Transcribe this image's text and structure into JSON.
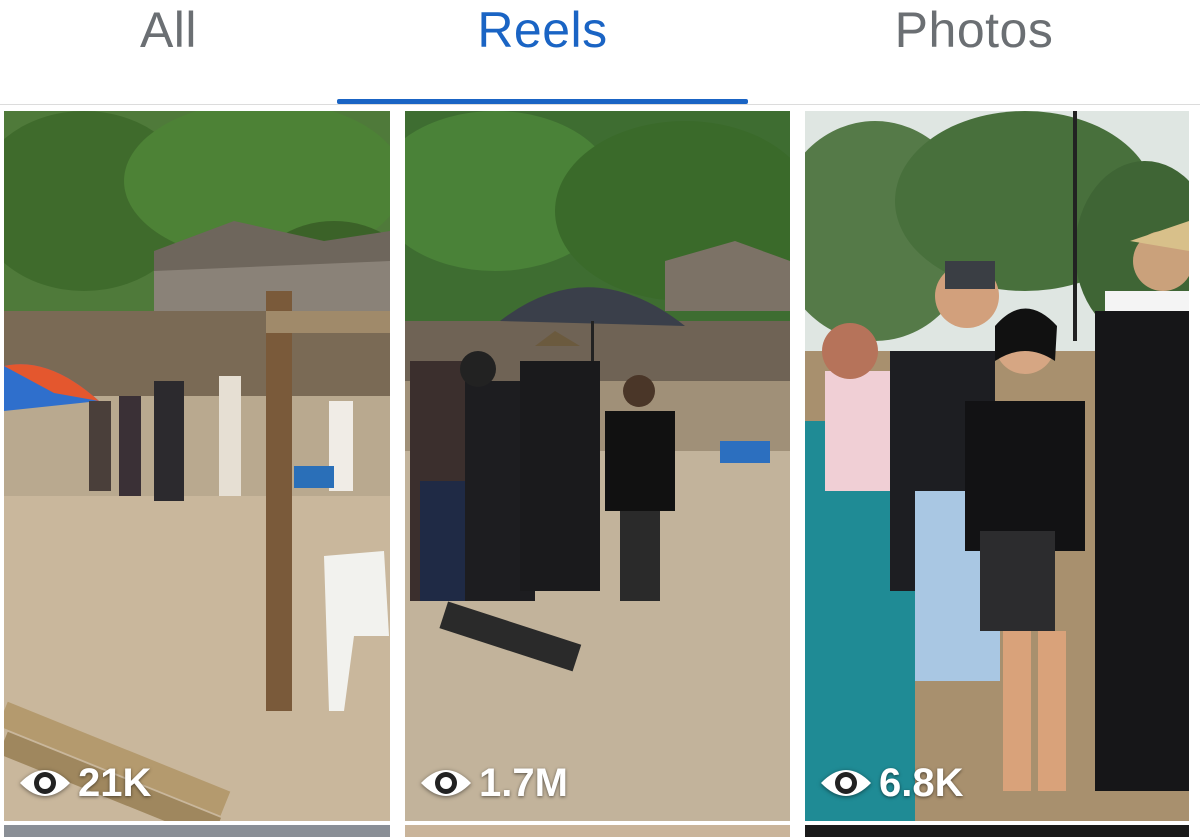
{
  "tabs": [
    {
      "label": "All",
      "active": false
    },
    {
      "label": "Reels",
      "active": true
    },
    {
      "label": "Photos",
      "active": false
    }
  ],
  "colors": {
    "active_tab": "#1a64c4",
    "inactive_tab": "#6b6f73",
    "overlay_text": "#ffffff"
  },
  "tiles": [
    {
      "views": "21K",
      "icon": "eye-icon"
    },
    {
      "views": "1.7M",
      "icon": "eye-icon"
    },
    {
      "views": "6.8K",
      "icon": "eye-icon"
    }
  ]
}
